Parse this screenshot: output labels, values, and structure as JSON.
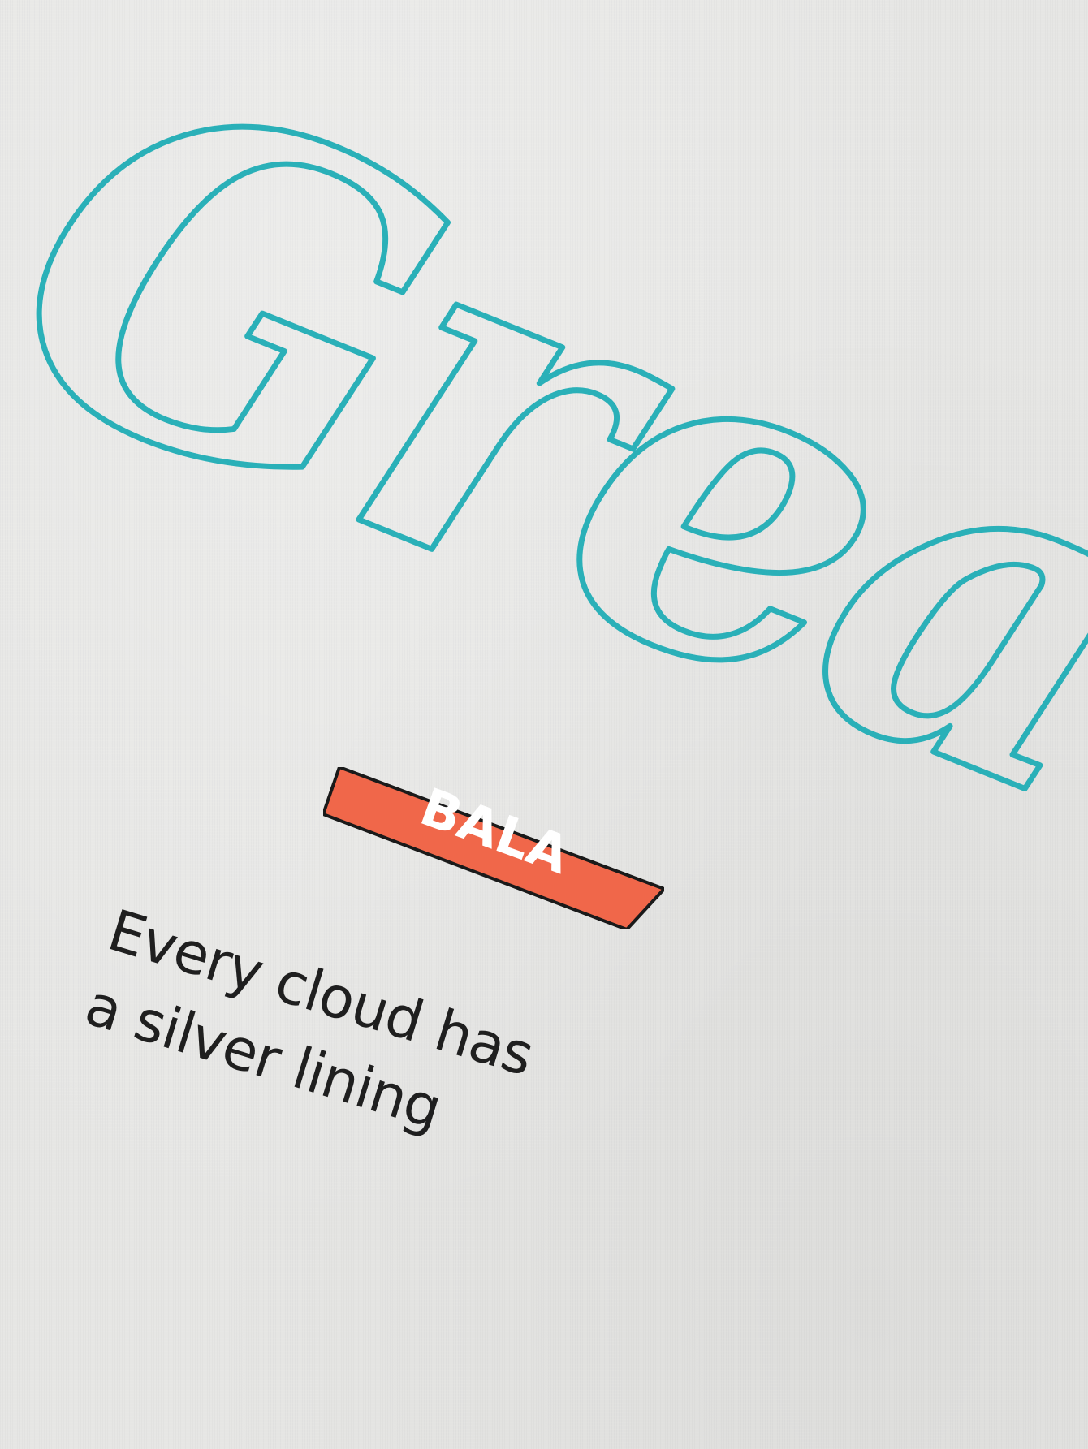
{
  "image": {
    "background_color": "#e6e6e4"
  },
  "print": {
    "script_word": "Grea",
    "script_color": "#2ab0b8",
    "badge": {
      "label": "BALA",
      "fill_color": "#f0674a",
      "border_color": "#1a1a1a"
    },
    "slogan": {
      "line1": "Every cloud has",
      "line2": "a silver lining",
      "color": "#1f1f1f"
    }
  }
}
